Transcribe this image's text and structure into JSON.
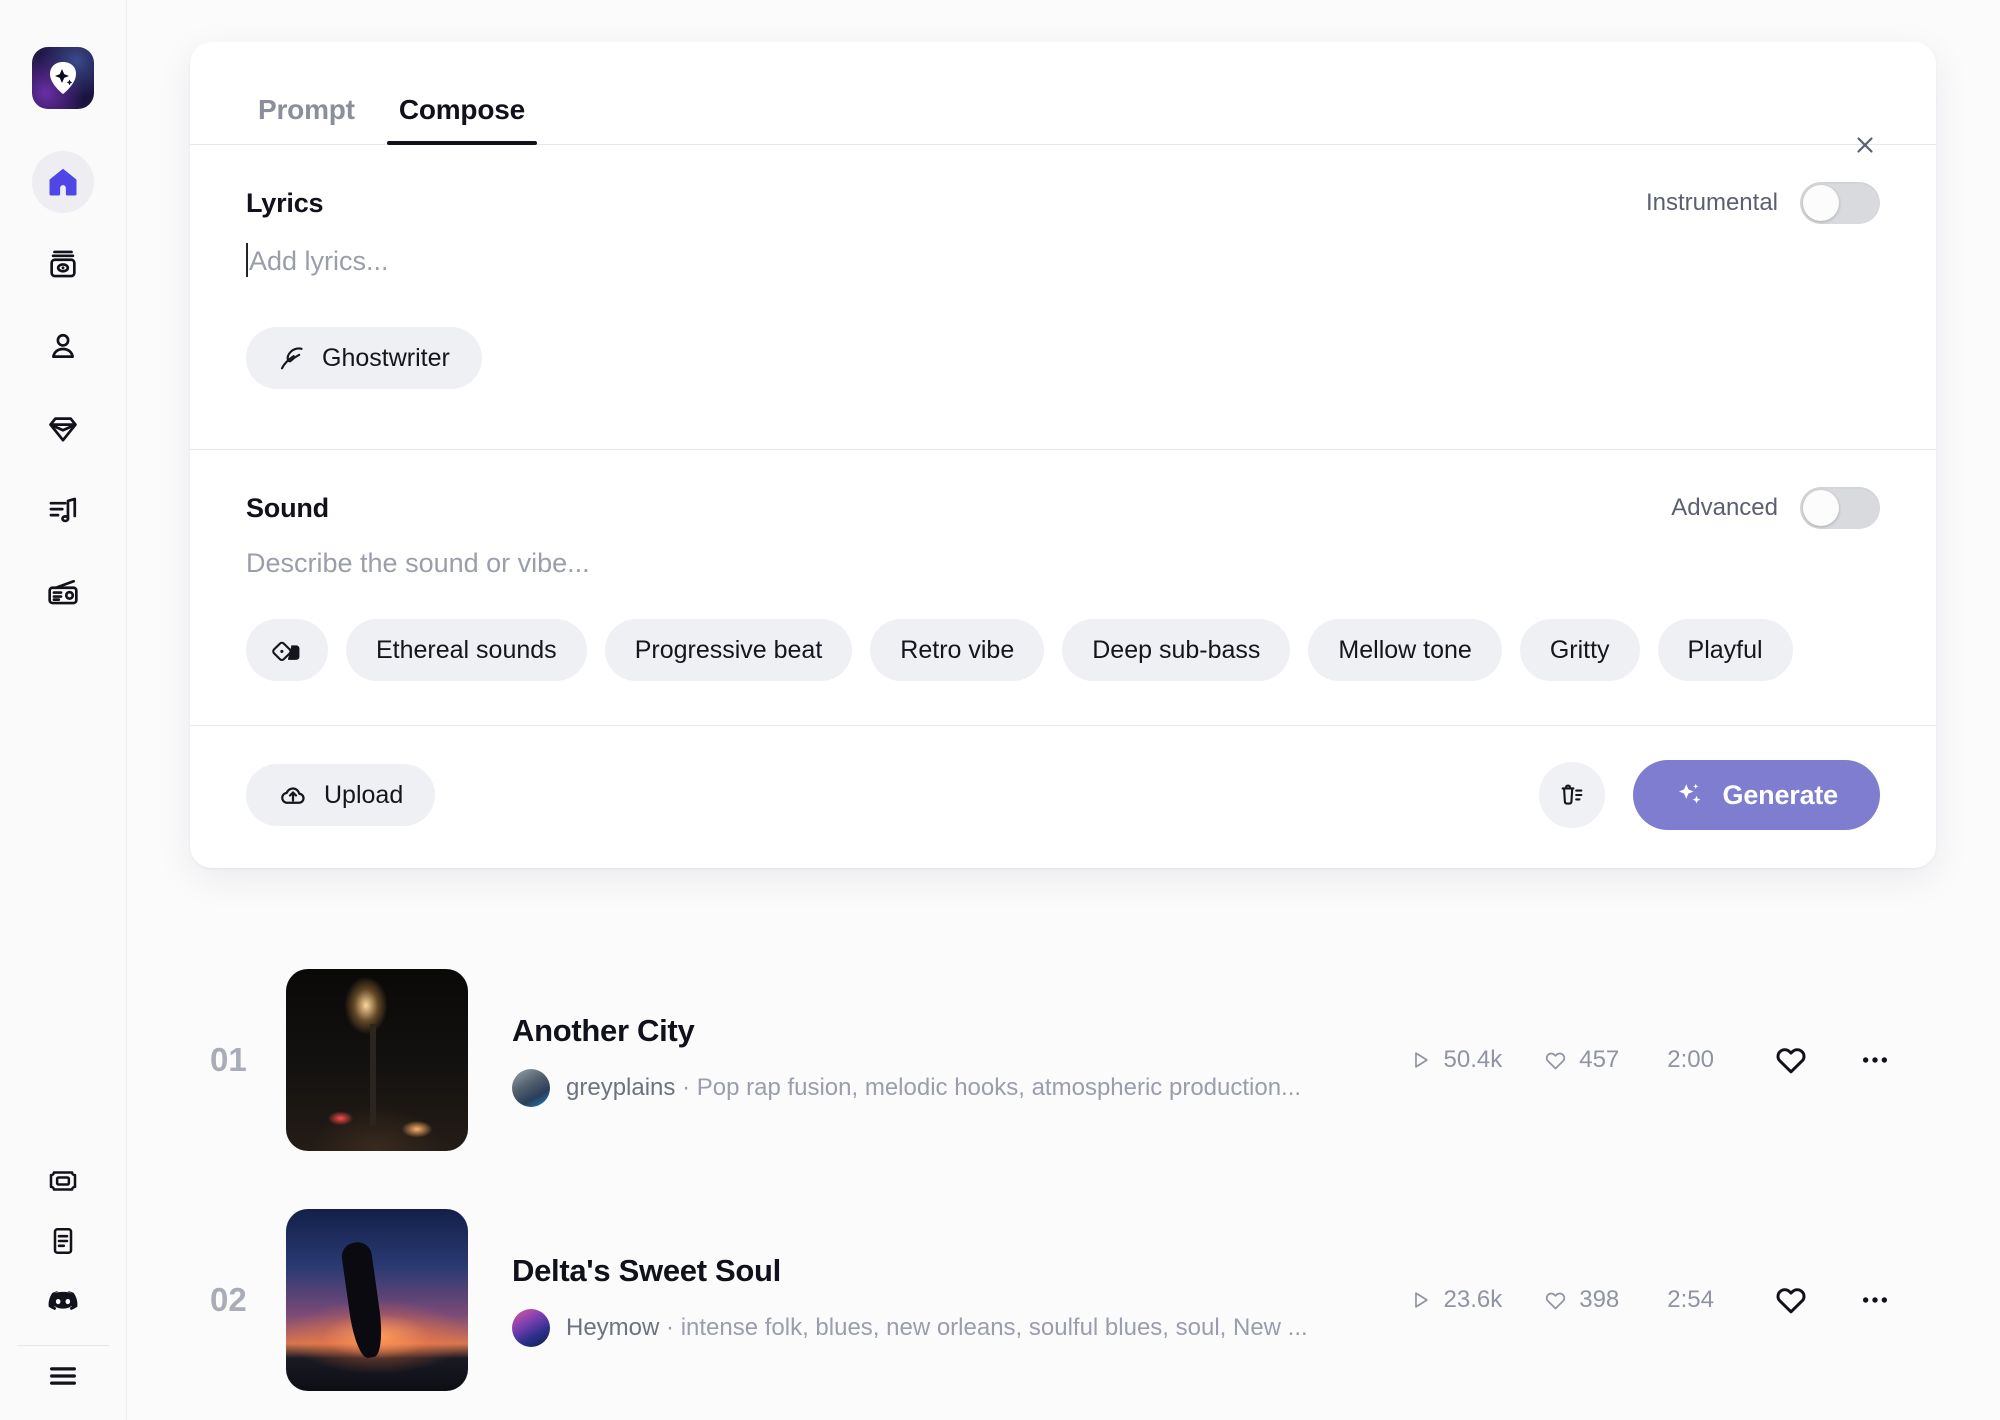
{
  "sidebar": {
    "logo_name": "app-logo-guitar-pick",
    "top_items": [
      {
        "icon": "home-icon",
        "active": true
      },
      {
        "icon": "library-box-icon",
        "active": false
      },
      {
        "icon": "person-icon",
        "active": false
      },
      {
        "icon": "diamond-icon",
        "active": false
      },
      {
        "icon": "playlist-music-icon",
        "active": false
      },
      {
        "icon": "radio-icon",
        "active": false
      }
    ],
    "bottom_items": [
      {
        "icon": "ticket-icon"
      },
      {
        "icon": "document-icon"
      },
      {
        "icon": "discord-icon"
      },
      {
        "icon": "hamburger-menu-icon"
      }
    ]
  },
  "composer": {
    "tabs": [
      {
        "label": "Prompt",
        "active": false
      },
      {
        "label": "Compose",
        "active": true
      }
    ],
    "close_icon": "close-icon",
    "lyrics": {
      "title": "Lyrics",
      "placeholder": "Add lyrics...",
      "value": "",
      "toggle_label": "Instrumental",
      "toggle_on": false,
      "ghostwriter_label": "Ghostwriter",
      "ghostwriter_icon": "feather-icon"
    },
    "sound": {
      "title": "Sound",
      "placeholder": "Describe the sound or vibe...",
      "value": "",
      "toggle_label": "Advanced",
      "toggle_on": false,
      "shuffle_icon": "dice-shuffle-icon",
      "chips": [
        "Ethereal sounds",
        "Progressive beat",
        "Retro vibe",
        "Deep sub-bass",
        "Mellow tone",
        "Gritty",
        "Playful"
      ]
    },
    "footer": {
      "upload_label": "Upload",
      "upload_icon": "cloud-upload-icon",
      "clear_icon": "trash-list-icon",
      "generate_label": "Generate",
      "generate_icon": "sparkles-icon",
      "generate_color": "#7e7dd0"
    }
  },
  "tracklist": [
    {
      "index": "01",
      "title": "Another City",
      "artist": "greyplains",
      "separator": "·",
      "tags": "Pop rap fusion, melodic hooks, atmospheric production...",
      "plays": "50.4k",
      "likes": "457",
      "duration": "2:00",
      "play_icon": "play-icon",
      "heart_icon": "heart-icon",
      "like_icon": "heart-outline-icon",
      "more_icon": "more-horizontal-icon"
    },
    {
      "index": "02",
      "title": "Delta's Sweet Soul",
      "artist": "Heymow",
      "separator": "·",
      "tags": "intense folk, blues, new orleans, soulful blues, soul, New ...",
      "plays": "23.6k",
      "likes": "398",
      "duration": "2:54",
      "play_icon": "play-icon",
      "heart_icon": "heart-icon",
      "like_icon": "heart-outline-icon",
      "more_icon": "more-horizontal-icon"
    }
  ]
}
